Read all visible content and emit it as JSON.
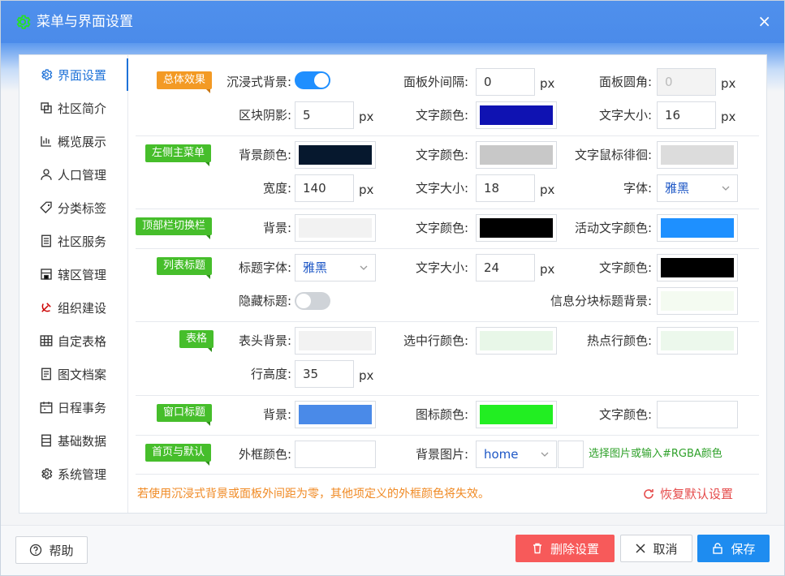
{
  "window": {
    "title": "菜单与界面设置",
    "close": "×"
  },
  "sidebar": {
    "items": [
      {
        "label": "界面设置",
        "icon": "gear-icon",
        "active": true
      },
      {
        "label": "社区简介",
        "icon": "copy-icon"
      },
      {
        "label": "概览展示",
        "icon": "bar-chart-icon"
      },
      {
        "label": "人口管理",
        "icon": "user-icon"
      },
      {
        "label": "分类标签",
        "icon": "tag-icon"
      },
      {
        "label": "社区服务",
        "icon": "building-icon"
      },
      {
        "label": "辖区管理",
        "icon": "store-icon"
      },
      {
        "label": "组织建设",
        "icon": "hammer-sickle-icon"
      },
      {
        "label": "自定表格",
        "icon": "table-icon"
      },
      {
        "label": "图文档案",
        "icon": "document-icon"
      },
      {
        "label": "日程事务",
        "icon": "calendar-icon"
      },
      {
        "label": "基础数据",
        "icon": "database-icon"
      },
      {
        "label": "系统管理",
        "icon": "gear-icon"
      }
    ]
  },
  "sections": {
    "overall": {
      "tag": "总体效果",
      "immersive_label": "沉浸式背景:",
      "immersive_on": true,
      "outer_gap_label": "面板外间隔:",
      "outer_gap_value": "0",
      "outer_gap_unit": "px",
      "radius_label": "面板圆角:",
      "radius_placeholder": "0",
      "radius_unit": "px",
      "shadow_label": "区块阴影:",
      "shadow_value": "5",
      "shadow_unit": "px",
      "text_color_label": "文字颜色:",
      "text_color": "#0f12b2",
      "font_size_label": "文字大小:",
      "font_size_value": "16",
      "font_size_unit": "px"
    },
    "left_menu": {
      "tag": "左侧主菜单",
      "bg_label": "背景颜色:",
      "bg_color": "#06182e",
      "text_color_label": "文字颜色:",
      "text_color": "#c8c8c8",
      "hover_label": "文字鼠标徘徊:",
      "hover_color": "#dcdcdc",
      "width_label": "宽度:",
      "width_value": "140",
      "width_unit": "px",
      "font_size_label": "文字大小:",
      "font_size_value": "18",
      "font_size_unit": "px",
      "font_label": "字体:",
      "font_value": "雅黑"
    },
    "top_bar": {
      "tag": "顶部栏切换栏",
      "bg_label": "背景:",
      "bg_color": "#f2f2f2",
      "text_color_label": "文字颜色:",
      "text_color": "#000000",
      "active_label": "活动文字颜色:",
      "active_color": "#1e90ff"
    },
    "list_title": {
      "tag": "列表标题",
      "font_label": "标题字体:",
      "font_value": "雅黑",
      "font_size_label": "文字大小:",
      "font_size_value": "24",
      "font_size_unit": "px",
      "text_color_label": "文字颜色:",
      "text_color": "#000000",
      "hide_label": "隐藏标题:",
      "hide_on": false,
      "info_bg_label": "信息分块标题背景:",
      "info_bg_color": "#f4fbf1"
    },
    "table": {
      "tag": "表格",
      "header_bg_label": "表头背景:",
      "header_bg_color": "#f2f2f2",
      "selected_label": "选中行颜色:",
      "selected_color": "#e8f7e8",
      "hot_label": "热点行颜色:",
      "hot_color": "#ecf8ec",
      "row_height_label": "行高度:",
      "row_height_value": "35",
      "row_height_unit": "px"
    },
    "window_title": {
      "tag": "窗口标题",
      "bg_label": "背景:",
      "bg_color": "#4a8ae8",
      "icon_color_label": "图标颜色:",
      "icon_color": "#22ee22",
      "text_color_label": "文字颜色:",
      "text_color": "#ffffff"
    },
    "home_default": {
      "tag": "首页与默认",
      "frame_label": "外框颜色:",
      "frame_color": "#ffffff",
      "bg_image_label": "背景图片:",
      "bg_image_value": "home",
      "hint": "选择图片或输入#RGBA颜色"
    }
  },
  "warning": "若使用沉浸式背景或面板外间距为零，其他项定义的外框颜色将失效。",
  "restore_label": "恢复默认设置",
  "footer": {
    "help": "帮助",
    "delete": "删除设置",
    "cancel": "取消",
    "save": "保存"
  }
}
